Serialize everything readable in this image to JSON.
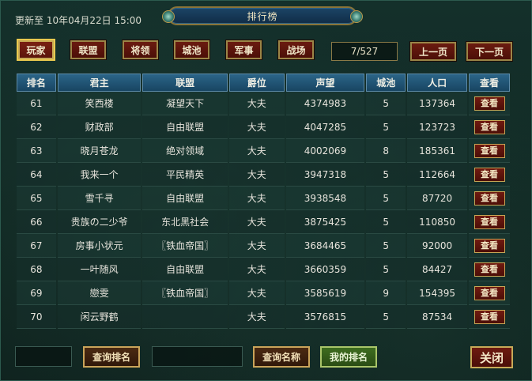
{
  "header": {
    "updated": "更新至 10年04月22日 15:00",
    "title": "排行榜"
  },
  "tabs": [
    {
      "label": "玩家",
      "active": true
    },
    {
      "label": "联盟",
      "active": false
    },
    {
      "label": "将领",
      "active": false
    },
    {
      "label": "城池",
      "active": false
    },
    {
      "label": "军事",
      "active": false
    },
    {
      "label": "战场",
      "active": false
    }
  ],
  "pagination": {
    "page": "7/527",
    "prev": "上一页",
    "next": "下一页"
  },
  "table": {
    "headers": [
      "排名",
      "君主",
      "联盟",
      "爵位",
      "声望",
      "城池",
      "人口",
      "查看"
    ],
    "rows": [
      {
        "rank": "61",
        "lord": "笑西楼",
        "alliance": "凝望天下",
        "title": "大夫",
        "prestige": "4374983",
        "cities": "5",
        "population": "137364",
        "view": "查看"
      },
      {
        "rank": "62",
        "lord": "财政部",
        "alliance": "自由联盟",
        "title": "大夫",
        "prestige": "4047285",
        "cities": "5",
        "population": "123723",
        "view": "查看"
      },
      {
        "rank": "63",
        "lord": "晓月苍龙",
        "alliance": "绝对领域",
        "title": "大夫",
        "prestige": "4002069",
        "cities": "8",
        "population": "185361",
        "view": "查看"
      },
      {
        "rank": "64",
        "lord": "我来一个",
        "alliance": "平民精英",
        "title": "大夫",
        "prestige": "3947318",
        "cities": "5",
        "population": "112664",
        "view": "查看"
      },
      {
        "rank": "65",
        "lord": "雪千寻",
        "alliance": "自由联盟",
        "title": "大夫",
        "prestige": "3938548",
        "cities": "5",
        "population": "87720",
        "view": "查看"
      },
      {
        "rank": "66",
        "lord": "贵族の二少爷",
        "alliance": "东北黑社会",
        "title": "大夫",
        "prestige": "3875425",
        "cities": "5",
        "population": "110850",
        "view": "查看"
      },
      {
        "rank": "67",
        "lord": "房事小状元",
        "alliance": "〖铁血帝国〗",
        "title": "大夫",
        "prestige": "3684465",
        "cities": "5",
        "population": "92000",
        "view": "查看"
      },
      {
        "rank": "68",
        "lord": "一叶随风",
        "alliance": "自由联盟",
        "title": "大夫",
        "prestige": "3660359",
        "cities": "5",
        "population": "84427",
        "view": "查看"
      },
      {
        "rank": "69",
        "lord": "戀雯",
        "alliance": "〖铁血帝国〗",
        "title": "大夫",
        "prestige": "3585619",
        "cities": "9",
        "population": "154395",
        "view": "查看"
      },
      {
        "rank": "70",
        "lord": "闲云野鹤",
        "alliance": "",
        "title": "大夫",
        "prestige": "3576815",
        "cities": "5",
        "population": "87534",
        "view": "查看"
      }
    ]
  },
  "footer": {
    "rank_input_value": "",
    "query_rank": "查询排名",
    "name_input_value": "",
    "query_name": "查询名称",
    "my_rank": "我的排名",
    "close": "关闭"
  }
}
